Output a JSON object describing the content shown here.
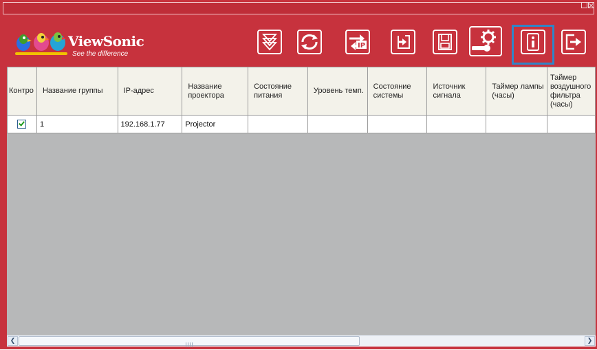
{
  "brand": {
    "name": "ViewSonic",
    "tagline": "See the difference"
  },
  "toolbar": [
    {
      "name": "download-icon"
    },
    {
      "name": "refresh-icon"
    },
    {
      "name": "ip-icon",
      "label": "IP"
    },
    {
      "name": "import-icon"
    },
    {
      "name": "save-icon"
    },
    {
      "name": "settings-icon"
    },
    {
      "name": "info-icon",
      "selected": true
    },
    {
      "name": "exit-icon"
    }
  ],
  "table": {
    "columns": [
      "Контро",
      "Название группы",
      "IP-адрес",
      "Название проектора",
      "Состояние питания",
      "Уровень темп.",
      "Состояние системы",
      "Источник сигнала",
      "Таймер лампы (часы)",
      "Таймер воздушного фильтра (часы)"
    ],
    "rows": [
      {
        "checked": true,
        "group": "1",
        "ip": "192.168.1.77",
        "projector": "Projector",
        "power": "",
        "temp": "",
        "system": "",
        "source": "",
        "lamp": "",
        "filter": ""
      }
    ]
  },
  "colors": {
    "background": "#c7323d",
    "table_bg": "#b7b8b9",
    "highlight": "#2f86c8"
  }
}
